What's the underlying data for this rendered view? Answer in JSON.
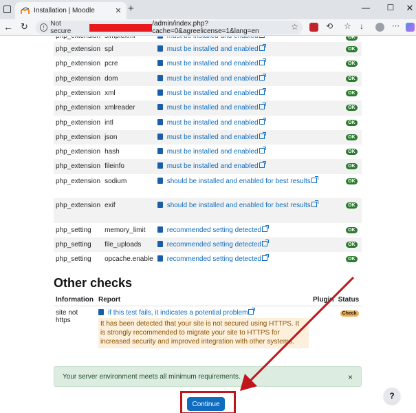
{
  "browser": {
    "tab_title": "Installation | Moodle",
    "tab_close": "✕",
    "new_tab": "+",
    "minimize": "—",
    "maximize": "☐",
    "not_secure": "Not secure",
    "url": "/admin/index.php?cache=0&agreelicense=1&lang=en",
    "accent": "#e8191c"
  },
  "env_rows": [
    {
      "type": "php_extension",
      "name": "simplexml",
      "report": "must be installed and enabled",
      "status": "OK",
      "ext": true
    },
    {
      "type": "php_extension",
      "name": "spl",
      "report": "must be installed and enabled",
      "status": "OK",
      "ext": true
    },
    {
      "type": "php_extension",
      "name": "pcre",
      "report": "must be installed and enabled",
      "status": "OK",
      "ext": true
    },
    {
      "type": "php_extension",
      "name": "dom",
      "report": "must be installed and enabled",
      "status": "OK",
      "ext": true
    },
    {
      "type": "php_extension",
      "name": "xml",
      "report": "must be installed and enabled",
      "status": "OK",
      "ext": true
    },
    {
      "type": "php_extension",
      "name": "xmlreader",
      "report": "must be installed and enabled",
      "status": "OK",
      "ext": true
    },
    {
      "type": "php_extension",
      "name": "intl",
      "report": "must be installed and enabled",
      "status": "OK",
      "ext": true
    },
    {
      "type": "php_extension",
      "name": "json",
      "report": "must be installed and enabled",
      "status": "OK",
      "ext": true
    },
    {
      "type": "php_extension",
      "name": "hash",
      "report": "must be installed and enabled",
      "status": "OK",
      "ext": true
    },
    {
      "type": "php_extension",
      "name": "fileinfo",
      "report": "must be installed and enabled",
      "status": "OK",
      "ext": true
    },
    {
      "type": "php_extension",
      "name": "sodium",
      "report": "should be installed and enabled for best results",
      "status": "OK",
      "ext": true
    },
    {
      "type": "php_extension",
      "name": "exif",
      "report": "should be installed and enabled for best results",
      "status": "OK",
      "ext": true
    },
    {
      "type": "php_setting",
      "name": "memory_limit",
      "report": "recommended setting detected",
      "status": "OK",
      "ext": true
    },
    {
      "type": "php_setting",
      "name": "file_uploads",
      "report": "recommended setting detected",
      "status": "OK",
      "ext": true
    },
    {
      "type": "php_setting",
      "name": "opcache.enable",
      "report": "recommended setting detected",
      "status": "OK",
      "ext": true
    }
  ],
  "other_checks": {
    "heading": "Other checks",
    "headers": {
      "information": "Information",
      "report": "Report",
      "plugin": "Plugin",
      "status": "Status"
    },
    "row": {
      "information": "site not https",
      "report_link": "if this test fails, it indicates a potential problem",
      "warning": "It has been detected that your site is not secured using HTTPS. It is strongly recommended to migrate your site to HTTPS for increased security and improved integration with other systems.",
      "status": "Check"
    }
  },
  "alert": {
    "message": "Your server environment meets all minimum requirements.",
    "close": "×"
  },
  "continue_label": "Continue",
  "help_label": "?"
}
